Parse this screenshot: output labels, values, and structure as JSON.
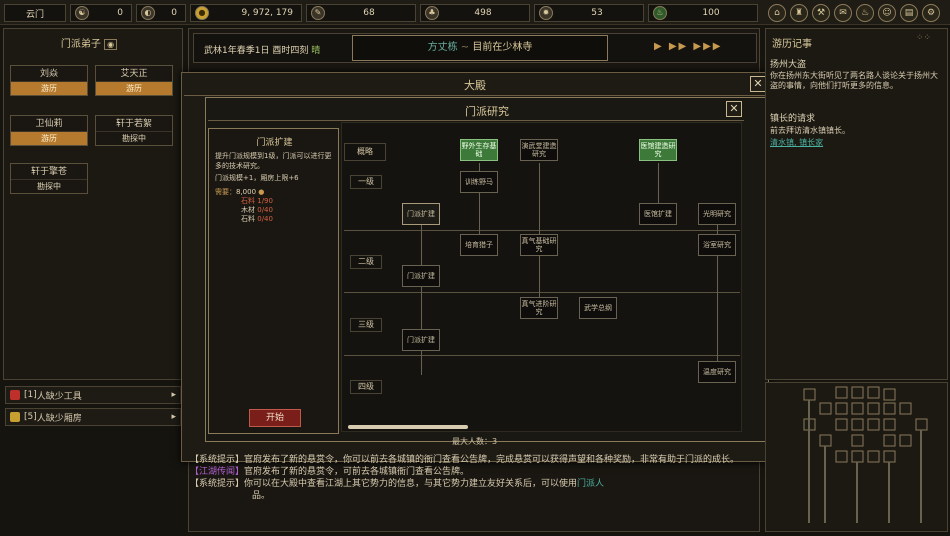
{
  "topbar": {
    "sect_label": "云门",
    "res1": {
      "icon": "yin-yang-icon",
      "value": "0"
    },
    "res2": {
      "icon": "taiji-icon",
      "value": "0"
    },
    "money": {
      "icon": "coin-icon",
      "value": "9, 972, 179"
    },
    "res4": {
      "icon": "brush-icon",
      "value": "68"
    },
    "res5": {
      "icon": "herb-icon",
      "value": "498"
    },
    "res6": {
      "icon": "ore-icon",
      "value": "53"
    },
    "res7": {
      "icon": "potion-icon",
      "value": "100"
    }
  },
  "sect_panel": {
    "title": "门派弟子",
    "disciples": [
      {
        "name": "刘焱",
        "status": "游历"
      },
      {
        "name": "艾天正",
        "status": "游历"
      },
      {
        "name": "卫仙莉",
        "status": "游历"
      },
      {
        "name": "轩于若絮",
        "status": "勘探中"
      },
      {
        "name": "轩于擎苍",
        "status": "勘探中"
      }
    ]
  },
  "alerts": [
    {
      "badge": "[1]",
      "text": "人缺少工具"
    },
    {
      "badge": "[5]",
      "text": "人缺少厢房"
    }
  ],
  "date_bar": {
    "date": "武林1年春季1日",
    "time": "酉时四刻",
    "weather": "晴",
    "location_name": "方丈栋",
    "location_sep": "~",
    "location_text": "目前在少林寺"
  },
  "hall": {
    "title": "大殿"
  },
  "research": {
    "title": "门派研究",
    "overview_label": "概略",
    "tiers": [
      "一级",
      "二级",
      "三级",
      "四级"
    ],
    "info": {
      "heading": "门派扩建",
      "desc": "提升门派规模到1级，门派可以进行更多的技术研究。",
      "effect": "门派规模+1，厢房上限+6",
      "cost_label": "需要：",
      "cost_value": "8,000",
      "cost_items": [
        {
          "name": "石料",
          "value": "1/90"
        },
        {
          "name": "木材",
          "value": "0/40"
        },
        {
          "name": "石料",
          "value": "0/40"
        }
      ],
      "start_button": "开始"
    },
    "nodes": {
      "n1": "门派扩建",
      "n2": "野外生存基础",
      "n3": "训练野马",
      "n4": "演武堂建造研究",
      "n5": "医馆建造研究",
      "n6": "医馆扩建",
      "n7": "光明研究",
      "n8": "培育猎子",
      "n9": "真气基础研究",
      "n10": "浴室研究",
      "n11": "门派扩建",
      "n12": "真气进阶研究",
      "n13": "武学总纲",
      "n14": "门派扩建",
      "n15": "温度研究"
    },
    "max_people_label": "最大人数：",
    "max_people_value": "3"
  },
  "log": {
    "line0": "【系统提示】官府发布了新的悬赏令，你可以前去各城镇的衙门查看公告牌，完成悬赏可以获得声望和各种奖励，非常有助于门派的成长。",
    "line1_tag": "【江湖传闻】",
    "line1": "官府发布了新的悬赏令，可前去各城镇衙门查看公告牌。",
    "line2_tag": "【系统提示】",
    "line2": "你可以在大殿中查看江湖上其它势力的信息，与其它势力建立友好关系后，可以使用",
    "line2_link": "门派人",
    "line2_end": "品。"
  },
  "journal": {
    "title": "游历记事",
    "entry1_title": "扬州大盗",
    "entry1_text": "你在扬州东大街听见了两名路人谈论关于扬州大盗的事情，向他们打听更多的信息。",
    "entry2_title": "镇长的请求",
    "entry2_text": "前去拜访清水镇镇长。",
    "entry2_link": "清水镇, 镇长家"
  }
}
